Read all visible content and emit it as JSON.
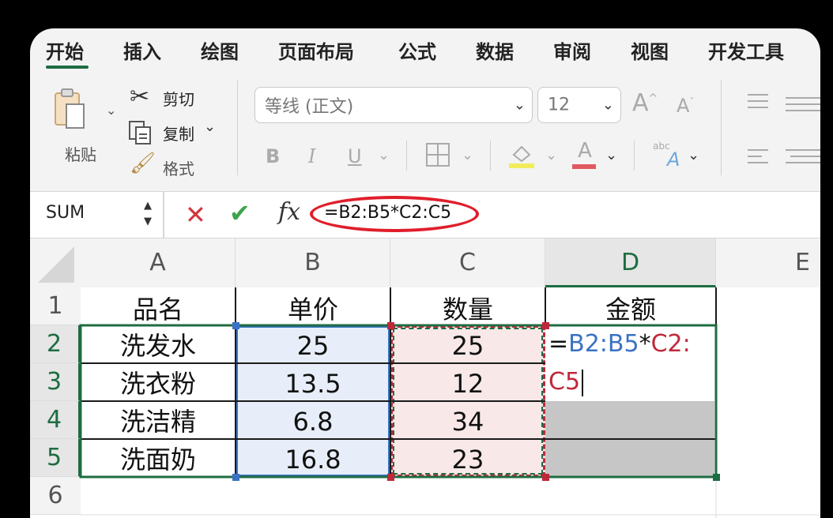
{
  "ribbon": {
    "tabs": [
      "开始",
      "插入",
      "绘图",
      "页面布局",
      "公式",
      "数据",
      "审阅",
      "视图",
      "开发工具"
    ],
    "paste_label": "粘贴",
    "cut_label": "剪切",
    "copy_label": "复制",
    "format_label": "格式",
    "font_name": "等线 (正文)",
    "font_size": "12",
    "grow_font": "A",
    "shrink_font": "A",
    "bold": "B",
    "italic": "I",
    "underline": "U",
    "phonetic_small": "abc",
    "phonetic_big": "A",
    "font_color_glyph": "A"
  },
  "formula_bar": {
    "name_box": "SUM",
    "fx": "fx",
    "formula": "=B2:B5*C2:C5"
  },
  "sheet": {
    "columns": [
      "A",
      "B",
      "C",
      "D",
      "E"
    ],
    "rows": [
      "1",
      "2",
      "3",
      "4",
      "5",
      "6"
    ],
    "header_row": [
      "品名",
      "单价",
      "数量",
      "金额"
    ],
    "data": [
      [
        "洗发水",
        "25",
        "25"
      ],
      [
        "洗衣粉",
        "13.5",
        "12"
      ],
      [
        "洗洁精",
        "6.8",
        "34"
      ],
      [
        "洗面奶",
        "16.8",
        "23"
      ]
    ],
    "edit_cell": {
      "eq": "=",
      "ref1": "B2:B5",
      "op": "*",
      "ref2_line1": "C2:",
      "ref2_line2": "C5"
    }
  },
  "colors": {
    "accent": "#1e6c41",
    "ref_blue": "#3a72c4",
    "ref_red": "#c0283a",
    "annotation": "#e01e2b"
  }
}
